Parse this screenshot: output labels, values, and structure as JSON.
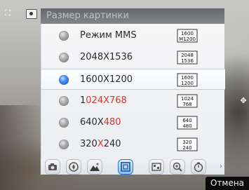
{
  "dialog": {
    "title": "Размер картинки"
  },
  "options": [
    {
      "label_parts": [
        "Режим MMS"
      ],
      "res_icon": [
        "1600",
        "M1200"
      ],
      "selected": false
    },
    {
      "label_parts": [
        "2048X1536"
      ],
      "res_icon": [
        "2048",
        "1536"
      ],
      "selected": false
    },
    {
      "label_parts": [
        "1600X1200"
      ],
      "res_icon": [
        "1600",
        "1200"
      ],
      "selected": true
    },
    {
      "label_parts": [
        "1",
        "024X768"
      ],
      "res_icon": [
        "1024",
        "768"
      ],
      "selected": false
    },
    {
      "label_parts": [
        "640X",
        "480"
      ],
      "res_icon": [
        "640",
        "480"
      ],
      "selected": false
    },
    {
      "label_parts": [
        "320",
        "X",
        "240"
      ],
      "res_icon": [
        "320",
        "240"
      ],
      "selected": false
    }
  ],
  "toolbar": {
    "tools": [
      {
        "icon": "camera-mode-icon"
      },
      {
        "icon": "focus-icon"
      },
      {
        "icon": "scene-mountain-icon"
      },
      {
        "icon": "picture-size-icon",
        "active": true
      },
      {
        "icon": "quality-icon"
      },
      {
        "icon": "zoom-icon"
      },
      {
        "icon": "timer-icon"
      }
    ],
    "more_arrow": "›"
  },
  "softkey": {
    "cancel_label": "Отмена"
  },
  "overlay": {
    "corner_glyph": "⛶",
    "right_glyph": "✥"
  },
  "colors": {
    "accent_red": "#d23a2a",
    "radio_selected": "#3f8cf0",
    "radio_unselected": "#9a9a9a",
    "toolbar_active": "#2c74c9"
  }
}
